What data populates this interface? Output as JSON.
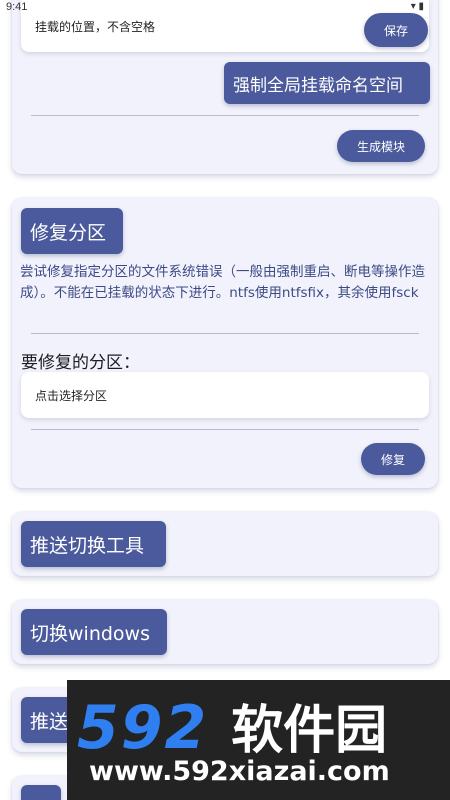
{
  "status_bar": {
    "time": "9:41"
  },
  "mount_card": {
    "mount_field_placeholder": "挂载的位置，不含空格",
    "save_label": "保存",
    "force_namespace_label": "强制全局挂载命名空间",
    "generate_module_label": "生成模块"
  },
  "repair_card": {
    "title": "修复分区",
    "description": "尝试修复指定分区的文件系统错误（一般由强制重启、断电等操作造成）。不能在已挂载的状态下进行。ntfs使用ntfsfix，其余使用fsck",
    "partition_label": "要修复的分区：",
    "partition_select_text": "点击选择分区",
    "repair_label": "修复"
  },
  "push_tool_card": {
    "title": "推送切换工具"
  },
  "switch_windows_card": {
    "title": "切换windows"
  },
  "partial_card": {
    "title": "推送"
  },
  "watermark": {
    "brand_num": "592",
    "brand_cn": "软件园",
    "url": "www.592xiazai.com"
  },
  "colors": {
    "accent": "#4b5a9c",
    "card_bg": "#f1f2fb",
    "desc_text": "#3d4a86"
  }
}
